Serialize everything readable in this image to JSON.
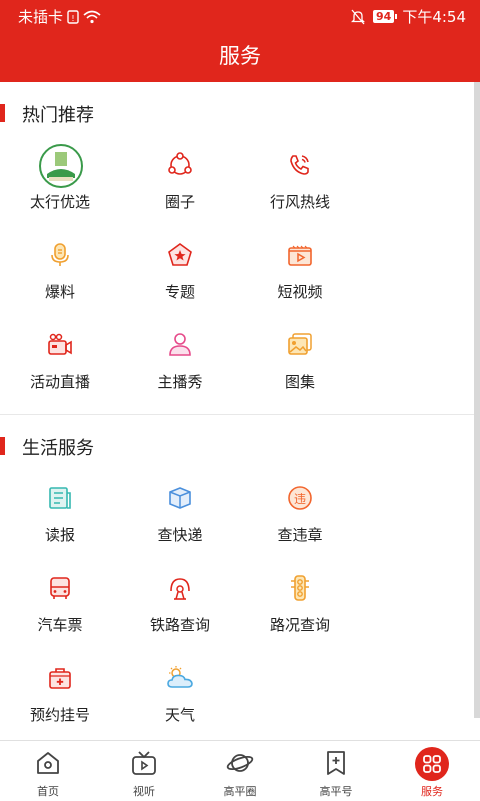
{
  "status": {
    "carrier": "未插卡",
    "battery": "94",
    "time": "下午4:54"
  },
  "header": {
    "title": "服务"
  },
  "sections": [
    {
      "title": "热门推荐",
      "items": [
        {
          "label": "太行优选",
          "icon": "taihang-logo-icon"
        },
        {
          "label": "圈子",
          "icon": "circle-network-icon"
        },
        {
          "label": "行风热线",
          "icon": "phone-icon"
        },
        {
          "label": "爆料",
          "icon": "microphone-icon"
        },
        {
          "label": "专题",
          "icon": "pentagon-star-icon"
        },
        {
          "label": "短视频",
          "icon": "video-clapper-icon"
        },
        {
          "label": "活动直播",
          "icon": "camera-icon"
        },
        {
          "label": "主播秀",
          "icon": "user-icon"
        },
        {
          "label": "图集",
          "icon": "gallery-icon"
        }
      ]
    },
    {
      "title": "生活服务",
      "items": [
        {
          "label": "读报",
          "icon": "newspaper-icon"
        },
        {
          "label": "查快递",
          "icon": "package-icon"
        },
        {
          "label": "查违章",
          "icon": "violation-icon"
        },
        {
          "label": "汽车票",
          "icon": "bus-icon"
        },
        {
          "label": "铁路查询",
          "icon": "railway-icon"
        },
        {
          "label": "路况查询",
          "icon": "traffic-light-icon"
        },
        {
          "label": "预约挂号",
          "icon": "medical-kit-icon"
        },
        {
          "label": "天气",
          "icon": "weather-icon"
        }
      ]
    }
  ],
  "tabs": [
    {
      "label": "首页",
      "icon": "home-icon"
    },
    {
      "label": "视听",
      "icon": "tv-icon"
    },
    {
      "label": "高平圈",
      "icon": "planet-icon"
    },
    {
      "label": "高平号",
      "icon": "bookmark-plus-icon"
    },
    {
      "label": "服务",
      "icon": "grid-icon",
      "active": true
    }
  ],
  "colors": {
    "primary": "#e0261c",
    "orange": "#f2652d",
    "teal": "#35b8b0"
  }
}
